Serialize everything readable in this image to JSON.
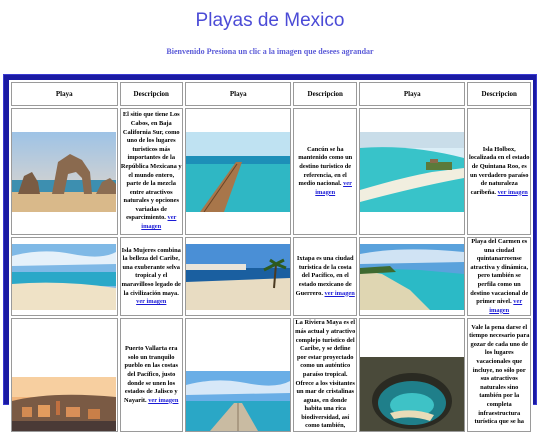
{
  "header": {
    "title": "Playas de Mexico",
    "welcome": "Bienvenido Presiona un clic a la imagen que desees agrandar"
  },
  "table": {
    "headers": [
      "Playa",
      "Descripcion",
      "Playa",
      "Descripcion",
      "Playa",
      "Descripcion"
    ],
    "link_label": "ver imagen",
    "rows": [
      [
        {
          "image": "los-cabos-arch-photo",
          "description": "El sitio que tiene Los Cabos, en Baja California Sur, como uno de los lugares turisticos más importantes de la República Mexicana y el mundo entero, parte de la mezcla entre atractivos naturales y opciones variadas de esparcimiento."
        },
        {
          "image": "cancun-pier-photo",
          "description": "Cancún se ha mantenido como un destino turistico de referencia, en el medio nacional."
        },
        {
          "image": "isla-holbox-photo",
          "description": "Isla Holbox, localizada en el estado de Quintana Roo, es un verdadero paraíso de naturaleza caribeña."
        }
      ],
      [
        {
          "image": "isla-mujeres-photo",
          "description": "Isla Mujeres combina la belleza del Caribe, una exuberante selva tropical y el maravilloso legado de la civilización maya."
        },
        {
          "image": "ixtapa-beach-photo",
          "description": "Ixtapa es una ciudad turistica de la costa del Pacífico, en el estado mexicano de Guerrero."
        },
        {
          "image": "playa-del-carmen-photo",
          "description": "Playa del Carmen es una ciudad quintanarroense atractiva y dinámica, pero también se perfila como un destino vacacional de primer nivel."
        }
      ],
      [
        {
          "image": "puerto-vallarta-photo",
          "description": "Puerto Vallarta era solo un tranquilo pueblo en las costas del Pacífico, justo donde se unen los estados de Jalisco y Nayarit."
        },
        {
          "image": "riviera-maya-pier-photo",
          "description": "La Riviera Maya es el más actual y atractivo complejo turistico del Caribe, y se define por estar proyectado como un auténtico paraíso tropical. Ofrece a los visitantes un mar de cristalinas aguas, en donde habita una rica biodiversidad, así como también,"
        },
        {
          "image": "marietas-hidden-beach-photo",
          "description": "Vale la pena darse el tiempo necesario para gozar de cada uno de los lugares vacacionales que incluye, no sólo por sus atractivos naturales sino también por la completa infraestructura turística que se ha"
        }
      ]
    ]
  },
  "colors": {
    "title": "#4b4bd6",
    "frame": "#1a1aa3",
    "link": "#1a1ad6"
  }
}
